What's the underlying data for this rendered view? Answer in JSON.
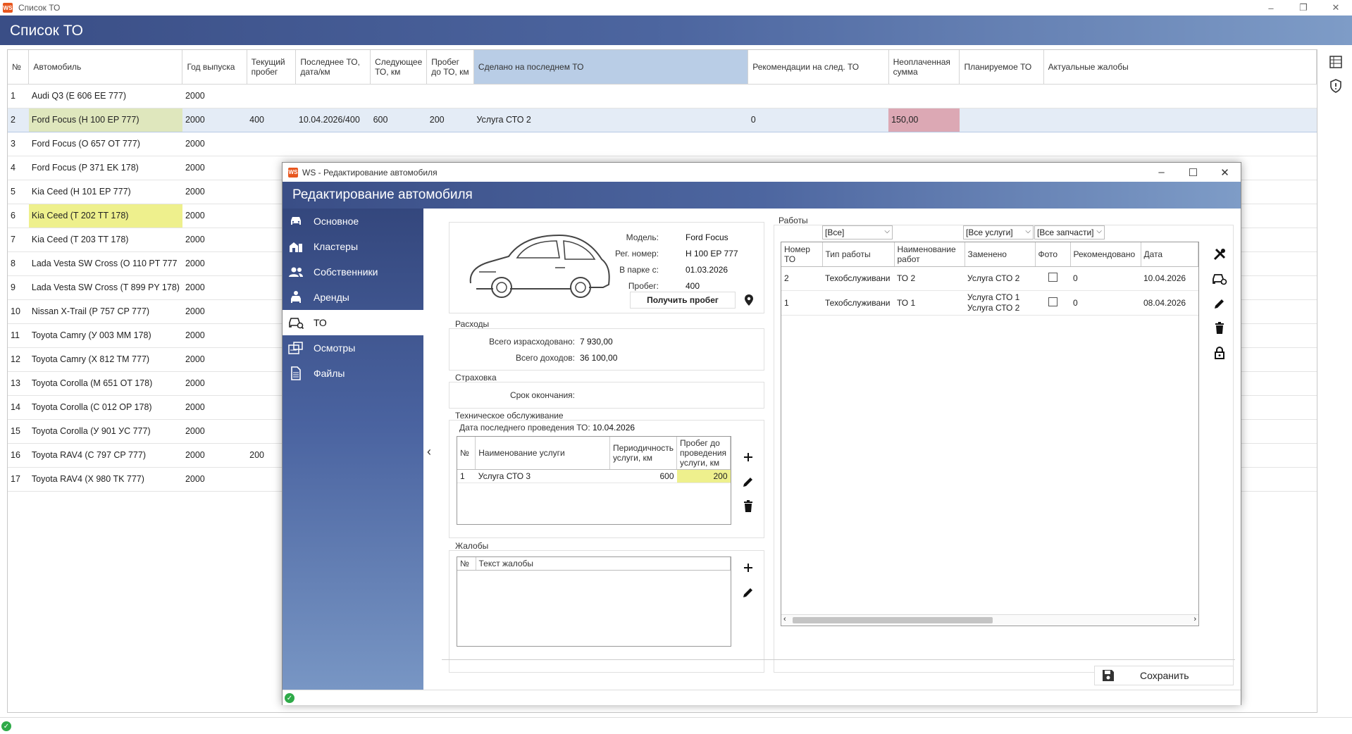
{
  "window": {
    "icon": "WS",
    "title": "Список ТО",
    "minimize": "–",
    "restore": "❐",
    "close": "✕"
  },
  "header": {
    "title": "Список ТО"
  },
  "table": {
    "columns": [
      "№",
      "Автомобиль",
      "Год выпуска",
      "Текущий пробег",
      "Последнее ТО, дата/км",
      "Следующее ТО, км",
      "Пробег до ТО, км",
      "Сделано на последнем ТО",
      "Рекомендации на след. ТО",
      "Неоплаченная сумма",
      "Планируемое ТО",
      "Актуальные жалобы"
    ],
    "rows": [
      {
        "n": "1",
        "car": "Audi Q3 (E 606 EE 777)",
        "year": "2000",
        "mileage": "",
        "last": "",
        "next": "",
        "left": "",
        "done": "",
        "rec": "",
        "unpaid": "",
        "planned": "",
        "complaints": ""
      },
      {
        "n": "2",
        "car": "Ford Focus (H 100 EP 777)",
        "year": "2000",
        "mileage": "400",
        "last": "10.04.2026/400",
        "next": "600",
        "left": "200",
        "done": "Услуга СТО 2",
        "rec": "0",
        "unpaid": "150,00",
        "planned": "",
        "complaints": ""
      },
      {
        "n": "3",
        "car": "Ford Focus (O 657 OT 777)",
        "year": "2000",
        "mileage": "",
        "last": "",
        "next": "",
        "left": "",
        "done": "",
        "rec": "",
        "unpaid": "",
        "planned": "",
        "complaints": ""
      },
      {
        "n": "4",
        "car": "Ford Focus (P 371 EK 178)",
        "year": "2000",
        "mileage": "",
        "last": "",
        "next": "",
        "left": "",
        "done": "",
        "rec": "",
        "unpaid": "",
        "planned": "",
        "complaints": ""
      },
      {
        "n": "5",
        "car": "Kia Ceed (H 101 EP 777)",
        "year": "2000",
        "mileage": "",
        "last": "",
        "next": "",
        "left": "",
        "done": "",
        "rec": "",
        "unpaid": "",
        "planned": "",
        "complaints": ""
      },
      {
        "n": "6",
        "car": "Kia Ceed (T 202 TT 178)",
        "year": "2000",
        "mileage": "",
        "last": "",
        "next": "",
        "left": "",
        "done": "",
        "rec": "",
        "unpaid": "",
        "planned": "",
        "complaints": ""
      },
      {
        "n": "7",
        "car": "Kia Ceed (T 203 TT 178)",
        "year": "2000",
        "mileage": "",
        "last": "",
        "next": "",
        "left": "",
        "done": "",
        "rec": "",
        "unpaid": "",
        "planned": "",
        "complaints": ""
      },
      {
        "n": "8",
        "car": "Lada Vesta SW Cross (O 110 PT 777",
        "year": "2000",
        "mileage": "",
        "last": "",
        "next": "",
        "left": "",
        "done": "",
        "rec": "",
        "unpaid": "",
        "planned": "",
        "complaints": ""
      },
      {
        "n": "9",
        "car": "Lada Vesta SW Cross (T 899 PY 178)",
        "year": "2000",
        "mileage": "",
        "last": "",
        "next": "",
        "left": "",
        "done": "",
        "rec": "",
        "unpaid": "",
        "planned": "",
        "complaints": ""
      },
      {
        "n": "10",
        "car": "Nissan X-Trail (P 757 CP 777)",
        "year": "2000",
        "mileage": "",
        "last": "",
        "next": "",
        "left": "",
        "done": "",
        "rec": "",
        "unpaid": "",
        "planned": "",
        "complaints": ""
      },
      {
        "n": "11",
        "car": "Toyota Camry (У 003 MM 178)",
        "year": "2000",
        "mileage": "",
        "last": "",
        "next": "",
        "left": "",
        "done": "",
        "rec": "",
        "unpaid": "",
        "planned": "",
        "complaints": ""
      },
      {
        "n": "12",
        "car": "Toyota Camry (X 812 TM 777)",
        "year": "2000",
        "mileage": "",
        "last": "",
        "next": "",
        "left": "",
        "done": "",
        "rec": "",
        "unpaid": "",
        "planned": "",
        "complaints": ""
      },
      {
        "n": "13",
        "car": "Toyota Corolla (M 651 OT 178)",
        "year": "2000",
        "mileage": "",
        "last": "",
        "next": "",
        "left": "",
        "done": "",
        "rec": "",
        "unpaid": "",
        "planned": "",
        "complaints": ""
      },
      {
        "n": "14",
        "car": "Toyota Corolla (C 012 OP 178)",
        "year": "2000",
        "mileage": "",
        "last": "",
        "next": "",
        "left": "",
        "done": "",
        "rec": "",
        "unpaid": "",
        "planned": "",
        "complaints": ""
      },
      {
        "n": "15",
        "car": "Toyota Corolla (У 901 УС 777)",
        "year": "2000",
        "mileage": "",
        "last": "",
        "next": "",
        "left": "",
        "done": "",
        "rec": "",
        "unpaid": "",
        "planned": "",
        "complaints": ""
      },
      {
        "n": "16",
        "car": "Toyota RAV4 (C 797 CP 777)",
        "year": "2000",
        "mileage": "200",
        "last": "",
        "next": "",
        "left": "",
        "done": "",
        "rec": "",
        "unpaid": "",
        "planned": "",
        "complaints": ""
      },
      {
        "n": "17",
        "car": "Toyota RAV4 (X 980 TK 777)",
        "year": "2000",
        "mileage": "",
        "last": "",
        "next": "",
        "left": "",
        "done": "",
        "rec": "",
        "unpaid": "",
        "planned": "",
        "complaints": ""
      }
    ]
  },
  "colors": {
    "header_from": "#3a4e86",
    "header_to": "#7e9cc7",
    "selected_row": "#e4ecf6",
    "car_green": "#dfe7bd",
    "car_yellow": "#eef08d",
    "unpaid_red": "#dca8b4",
    "ok_green": "#2eaa48"
  },
  "dialog": {
    "icon": "WS",
    "title": "WS - Редактирование автомобиля",
    "minimize": "–",
    "maximize": "☐",
    "close": "✕",
    "header": "Редактирование автомобиля",
    "nav": [
      {
        "label": "Основное",
        "icon": "car-icon"
      },
      {
        "label": "Кластеры",
        "icon": "buildings-icon"
      },
      {
        "label": "Собственники",
        "icon": "people-icon"
      },
      {
        "label": "Аренды",
        "icon": "car-person-icon"
      },
      {
        "label": "ТО",
        "icon": "car-service-icon"
      },
      {
        "label": "Осмотры",
        "icon": "inspection-icon"
      },
      {
        "label": "Файлы",
        "icon": "file-icon"
      }
    ],
    "collapse": "‹",
    "car": {
      "model_label": "Модель:",
      "model": "Ford Focus",
      "reg_label": "Рег. номер:",
      "reg": "H 100 EP 777",
      "park_label": "В парке с:",
      "park": "01.03.2026",
      "mileage_label": "Пробег:",
      "mileage": "400",
      "get_mileage_button": "Получить пробег"
    },
    "expenses": {
      "title": "Расходы",
      "spent_label": "Всего израсходовано:",
      "spent": "7 930,00",
      "income_label": "Всего доходов:",
      "income": "36 100,00"
    },
    "insurance": {
      "title": "Страховка",
      "end_label": "Срок окончания:"
    },
    "service": {
      "title": "Техническое обслуживание",
      "last_label": "Дата последнего проведения ТО:",
      "last": "10.04.2026",
      "columns": [
        "№",
        "Наименование услуги",
        "Периодичность услуги, км",
        "Пробег до проведения услуги, км"
      ],
      "rows": [
        {
          "n": "1",
          "name": "Услуга СТО 3",
          "period": "600",
          "left": "200"
        }
      ]
    },
    "complaints": {
      "title": "Жалобы",
      "columns": [
        "№",
        "Текст жалобы"
      ]
    },
    "works": {
      "title": "Работы",
      "filter_all": "[Все]",
      "filter_services": "[Все услуги]",
      "filter_parts": "[Все запчасти]",
      "columns": [
        "Номер ТО",
        "Тип работы",
        "Наименование работ",
        "Заменено",
        "Фото",
        "Рекомендовано",
        "Дата"
      ],
      "rows": [
        {
          "n": "2",
          "type": "Техобслуживани",
          "name": "ТО 2",
          "replaced": "Услуга СТО 2",
          "replaced2": "",
          "rec": "0",
          "date": "10.04.2026"
        },
        {
          "n": "1",
          "type": "Техобслуживани",
          "name": "ТО 1",
          "replaced": "Услуга СТО 1",
          "replaced2": "Услуга СТО 2",
          "rec": "0",
          "date": "08.04.2026"
        }
      ]
    },
    "save_button": "Сохранить"
  }
}
